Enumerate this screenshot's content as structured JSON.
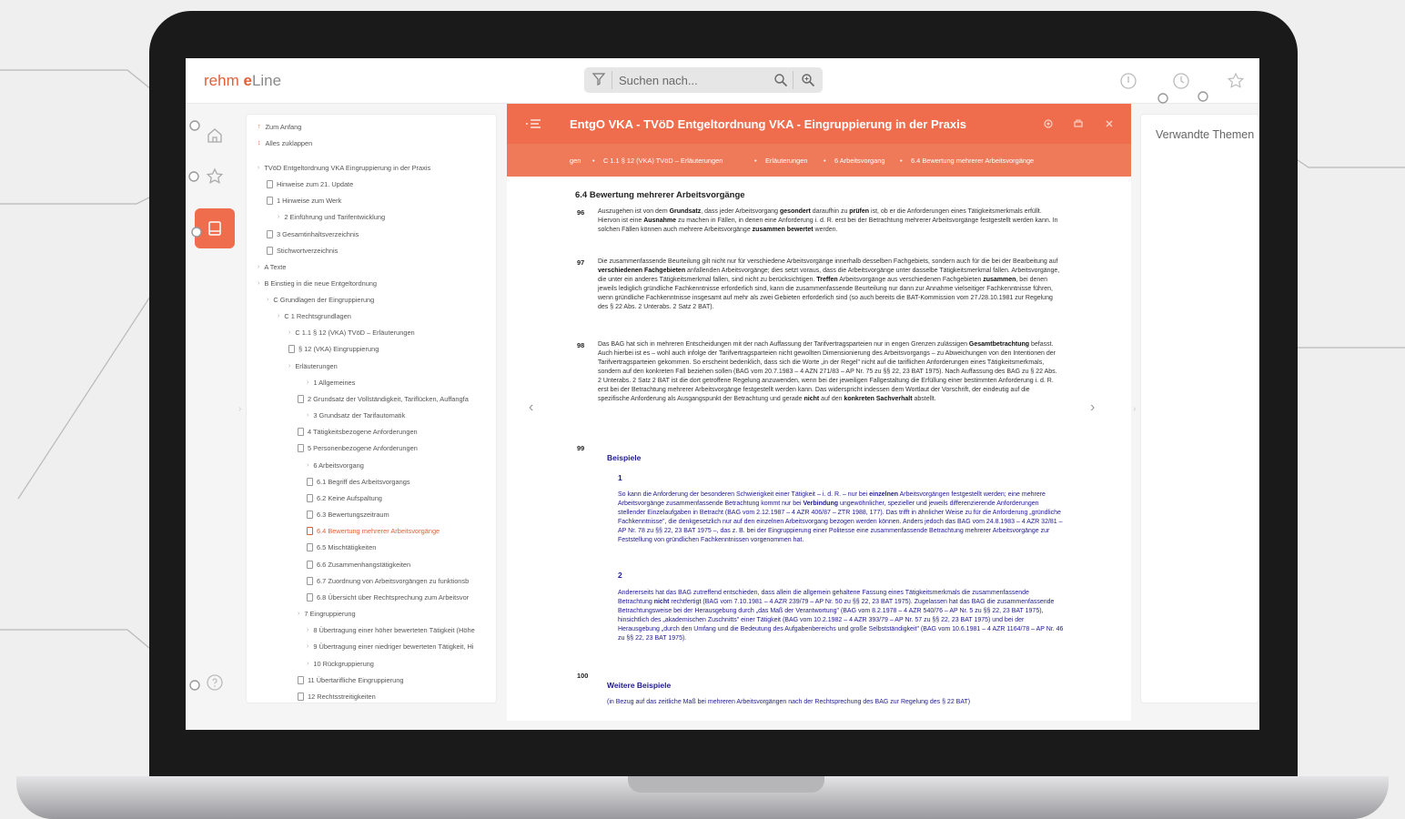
{
  "app": {
    "logo_rehm": "rehm ",
    "logo_e": "e",
    "logo_line": "Line"
  },
  "search": {
    "placeholder": "Suchen nach..."
  },
  "rail": {
    "items": [
      "home-icon",
      "star-icon",
      "book-icon",
      "help-icon"
    ]
  },
  "toc": {
    "items": [
      {
        "label": "Zum Anfang",
        "kind": "arrow"
      },
      {
        "label": "Alles zuklappen",
        "kind": "arrow"
      },
      {
        "label": "TVöD Entgeltordnung VKA Eingruppierung in der Praxis",
        "kind": "chev"
      },
      {
        "label": "Hinweise zum 21. Update",
        "kind": "doc"
      },
      {
        "label": "1 Hinweise zum Werk",
        "kind": "doc"
      },
      {
        "label": "2 Einführung und Tarifentwicklung",
        "kind": "chev"
      },
      {
        "label": "3 Gesamtinhaltsverzeichnis",
        "kind": "doc"
      },
      {
        "label": "Stichwortverzeichnis",
        "kind": "doc"
      },
      {
        "label": "A Texte",
        "kind": "chev"
      },
      {
        "label": "B Einstieg in die neue Entgeltordnung",
        "kind": "chev"
      },
      {
        "label": "C Grundlagen der Eingruppierung",
        "kind": "chev"
      },
      {
        "label": "C 1 Rechtsgrundlagen",
        "kind": "chev"
      },
      {
        "label": "C 1.1 § 12 (VKA) TVöD – Erläuterungen",
        "kind": "chev"
      },
      {
        "label": "§ 12 (VKA) Eingruppierung",
        "kind": "doc"
      },
      {
        "label": "Erläuterungen",
        "kind": "chev"
      },
      {
        "label": "1 Allgemeines",
        "kind": "chev"
      },
      {
        "label": "2 Grundsatz der Vollständigkeit, Tariflücken, Auffangfa",
        "kind": "doc"
      },
      {
        "label": "3 Grundsatz der Tarifautomatik",
        "kind": "chev"
      },
      {
        "label": "4 Tätigkeitsbezogene Anforderungen",
        "kind": "doc"
      },
      {
        "label": "5 Personenbezogene Anforderungen",
        "kind": "doc"
      },
      {
        "label": "6 Arbeitsvorgang",
        "kind": "chev"
      },
      {
        "label": "6.1 Begriff des Arbeitsvorgangs",
        "kind": "doc"
      },
      {
        "label": "6.2 Keine Aufspaltung",
        "kind": "doc"
      },
      {
        "label": "6.3 Bewertungszeitraum",
        "kind": "doc"
      },
      {
        "label": "6.4 Bewertung mehrerer Arbeitsvorgänge",
        "kind": "doc"
      },
      {
        "label": "6.5 Mischtätigkeiten",
        "kind": "doc"
      },
      {
        "label": "6.6 Zusammenhangstätigkeiten",
        "kind": "doc"
      },
      {
        "label": "6.7 Zuordnung von Arbeitsvorgängen zu funktionsb",
        "kind": "doc"
      },
      {
        "label": "6.8 Übersicht über Rechtsprechung zum Arbeitsvor",
        "kind": "doc"
      },
      {
        "label": "7 Eingruppierung",
        "kind": "chev"
      },
      {
        "label": "8 Übertragung einer höher bewerteten Tätigkeit (Höhe",
        "kind": "chev"
      },
      {
        "label": "9 Übertragung einer niedriger bewerteten Tätigkeit, Hi",
        "kind": "chev"
      },
      {
        "label": "10 Rückgruppierung",
        "kind": "chev"
      },
      {
        "label": "11 Übertarifliche Eingruppierung",
        "kind": "doc"
      },
      {
        "label": "12 Rechtsstreitigkeiten",
        "kind": "doc"
      }
    ]
  },
  "doc": {
    "title": "EntgO VKA - TVöD Entgeltordnung VKA - Eingruppierung in der Praxis",
    "breadcrumb": [
      "gen",
      "C 1.1 § 12 (VKA) TVöD – Erläuterungen",
      "Erläuterungen",
      "6 Arbeitsvorgang",
      "6.4 Bewertung mehrerer Arbeitsvorgänge"
    ],
    "breadcrumb_sep": "•",
    "section_heading": "6.4 Bewertung mehrerer Arbeitsvorgänge",
    "p96_num": "96",
    "p96_a": "Auszugehen ist von dem ",
    "p96_b": "Grundsatz",
    "p96_c": ", dass jeder Arbeitsvorgang ",
    "p96_d": "gesondert",
    "p96_e": " daraufhin zu ",
    "p96_f": "prüfen",
    "p96_g": " ist, ob er die Anforderungen eines Tätigkeitsmerkmals erfüllt. Hiervon ist eine ",
    "p96_h": "Ausnahme",
    "p96_i": " zu machen in Fällen, in denen eine Anforderung i. d. R. erst bei der Betrachtung mehrerer Arbeitsvorgänge festgestellt werden kann. In solchen Fällen können auch mehrere Arbeitsvorgänge ",
    "p96_j": "zusammen bewertet",
    "p96_k": " werden.",
    "p97_num": "97",
    "p97_a": "Die zusammenfassende Beurteilung gilt nicht nur für verschiedene Arbeitsvorgänge innerhalb desselben Fachgebiets, sondern auch für die bei der Bearbeitung auf ",
    "p97_b": "verschiedenen Fachgebieten",
    "p97_c": " anfallenden Arbeitsvorgänge; dies setzt voraus, dass die Arbeitsvorgänge unter dasselbe Tätigkeitsmerkmal fallen. Arbeitsvorgänge, die unter ein anderes Tätigkeitsmerkmal fallen, sind nicht zu berücksichtigen. ",
    "p97_d": "Treffen",
    "p97_e": " Arbeitsvorgänge aus verschiedenen Fachgebieten ",
    "p97_f": "zusammen",
    "p97_g": ", bei denen jeweils lediglich gründliche Fachkenntnisse erforderlich sind, kann die zusammenfassende Beurteilung nur dann zur Annahme vielseitiger Fachkenntnisse führen, wenn gründliche Fachkenntnisse insgesamt auf mehr als zwei Gebieten erforderlich sind (so auch bereits die BAT-Kommission vom 27./28.10.1981 zur Regelung des § 22 Abs. 2 Unterabs. 2 Satz 2 BAT).",
    "p98_num": "98",
    "p98_a": "Das BAG hat sich in mehreren Entscheidungen mit der nach Auffassung der Tarifvertragsparteien nur in engen Grenzen zulässigen ",
    "p98_b": "Gesamtbetrachtung",
    "p98_c": " befasst. Auch hierbei ist es – wohl auch infolge der Tarifvertragsparteien nicht gewollten Dimensionierung des Arbeitsvorgangs – zu Abweichungen von den Intentionen der Tarifvertragsparteien gekommen. So erscheint bedenklich, dass sich die Worte „in der Regel\" nicht auf die tariflichen Anforderungen eines Tätigkeitsmerkmals, sondern auf den konkreten Fall beziehen sollen (BAG vom 20.7.1983 – 4 AZN 271/83 – AP Nr. 75 zu §§ 22, 23 BAT 1975). Nach Auffassung des BAG zu § 22 Abs. 2 Unterabs. 2 Satz 2 BAT ist die dort getroffene Regelung anzuwenden, wenn bei der jeweiligen Fallgestaltung die Erfüllung einer bestimmten Anforderung i. d. R. erst bei der Betrachtung mehrerer Arbeitsvorgänge festgestellt werden kann. Das widerspricht indessen dem Wortlaut der Vorschrift, der eindeutig auf die spezifische Anforderung als Ausgangspunkt der Betrachtung und gerade ",
    "p98_d": "nicht",
    "p98_e": " auf den ",
    "p98_f": "konkreten Sachverhalt",
    "p98_g": " abstellt.",
    "p99_num": "99",
    "beispiele": "Beispiele",
    "b1_num": "1",
    "b1_a": "So kann die Anforderung der besonderen Schwierigkeit einer Tätigkeit – i. d. R. – nur bei ",
    "b1_b": "einzelnen",
    "b1_c": " Arbeitsvorgängen festgestellt werden; eine mehrere Arbeitsvorgänge zusammenfassende Betrachtung kommt nur bei ",
    "b1_d": "Verbindung",
    "b1_e": " ungewöhnlicher, spezieller und jeweils differenzierende Anforderungen stellender Einzelaufgaben in Betracht (BAG vom 2.12.1987 – 4 AZR 406/87 – ZTR 1988, 177). Das trifft in ähnlicher Weise zu für die Anforderung „gründliche Fachkenntnisse\", die denkgesetzlich nur auf den einzelnen Arbeitsvorgang bezogen werden können. Anders jedoch das BAG vom 24.8.1983 – 4 AZR 32/81 – AP Nr. 78 zu §§ 22, 23 BAT 1975 –, das z. B. bei der Eingruppierung einer Politesse eine zusammenfassende Betrachtung mehrerer Arbeitsvorgänge zur Feststellung von gründlichen Fachkenntnissen vorgenommen hat.",
    "b2_num": "2",
    "b2_a": "Andererseits hat das BAG zutreffend entschieden, dass allein die allgemein gehaltene Fassung eines Tätigkeitsmerkmals die zusammenfassende Betrachtung ",
    "b2_b": "nicht",
    "b2_c": " rechtfertigt (BAG vom 7.10.1981 – 4 AZR 239/79 – AP Nr. 50 zu §§ 22, 23 BAT 1975). Zugelassen hat das BAG die zusammenfassende Betrachtungsweise bei der Herausgebung durch „das Maß der Verantwortung\" (BAG vom 8.2.1978 – 4 AZR 540/76 – AP Nr. 5 zu §§ 22, 23 BAT 1975), hinsichtlich des „akademischen Zuschnitts\" einer Tätigkeit (BAG vom 10.2.1982 – 4 AZR 393/79 – AP Nr. 57 zu §§ 22, 23 BAT 1975) und bei der Herausgebung „durch den Umfang und die Bedeutung des Aufgabenbereichs und große Selbstständigkeit\" (BAG vom 10.6.1981 – 4 AZR 1164/78 – AP Nr. 46 zu §§ 22, 23 BAT 1975).",
    "p100_num": "100",
    "weitere": "Weitere Beispiele",
    "weitere_text": "(in Bezug auf das zeitliche Maß bei mehreren Arbeitsvorgängen nach der Rechtsprechung des BAG zur Regelung des § 22 BAT)"
  },
  "right_panel": {
    "title": "Verwandte Themen"
  },
  "colors": {
    "accent": "#ef6c4d",
    "blue_text": "#1f1a8f"
  }
}
